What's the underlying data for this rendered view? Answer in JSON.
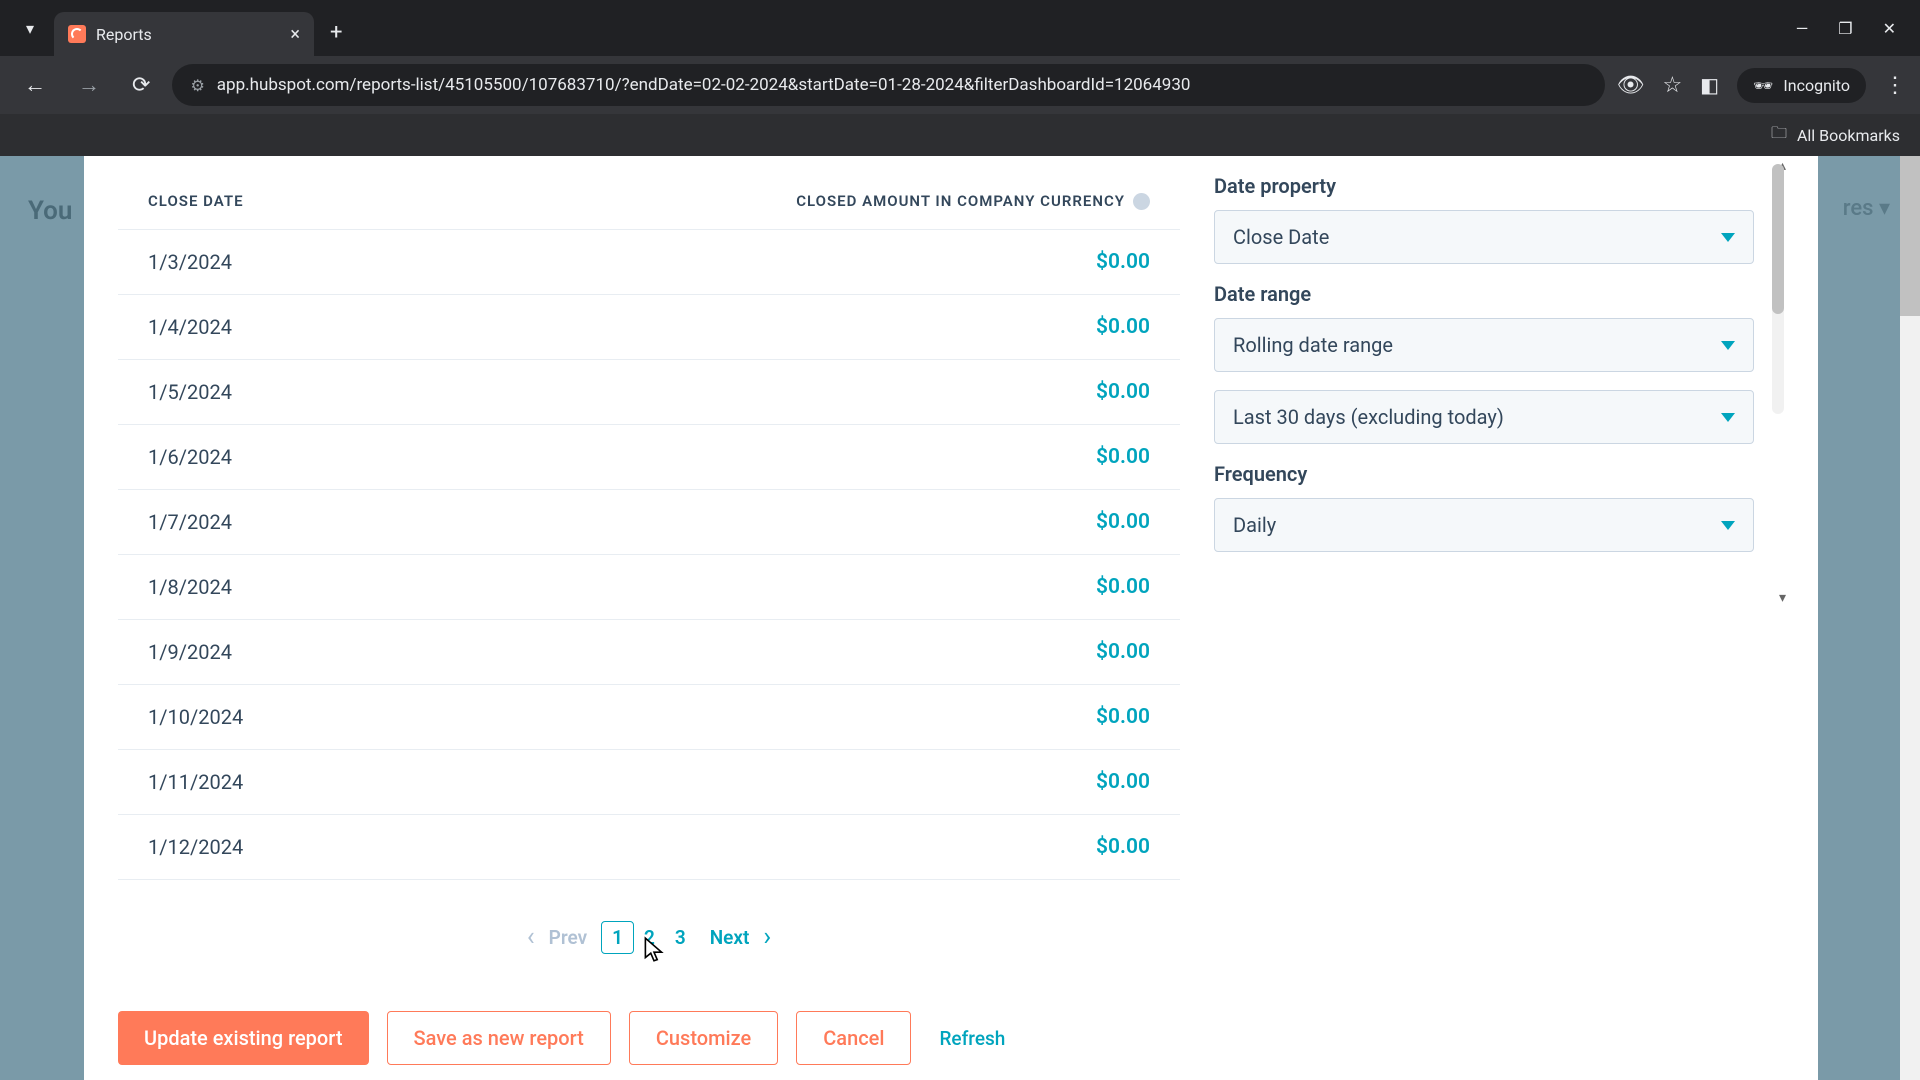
{
  "browser": {
    "tab_title": "Reports",
    "url": "app.hubspot.com/reports-list/45105500/107683710/?endDate=02-02-2024&startDate=01-28-2024&filterDashboardId=12064930",
    "incognito_label": "Incognito",
    "bookmarks_label": "All Bookmarks"
  },
  "background": {
    "you_text": "You",
    "right_text": "res"
  },
  "table": {
    "col1": "CLOSE DATE",
    "col2": "CLOSED AMOUNT IN COMPANY CURRENCY",
    "rows": [
      {
        "date": "1/3/2024",
        "amount": "$0.00"
      },
      {
        "date": "1/4/2024",
        "amount": "$0.00"
      },
      {
        "date": "1/5/2024",
        "amount": "$0.00"
      },
      {
        "date": "1/6/2024",
        "amount": "$0.00"
      },
      {
        "date": "1/7/2024",
        "amount": "$0.00"
      },
      {
        "date": "1/8/2024",
        "amount": "$0.00"
      },
      {
        "date": "1/9/2024",
        "amount": "$0.00"
      },
      {
        "date": "1/10/2024",
        "amount": "$0.00"
      },
      {
        "date": "1/11/2024",
        "amount": "$0.00"
      },
      {
        "date": "1/12/2024",
        "amount": "$0.00"
      }
    ]
  },
  "pagination": {
    "prev": "Prev",
    "pages": [
      "1",
      "2",
      "3"
    ],
    "current": "1",
    "next": "Next"
  },
  "filters": {
    "date_property_label": "Date property",
    "date_property_value": "Close Date",
    "date_range_label": "Date range",
    "date_range_value": "Rolling date range",
    "date_range_value2": "Last 30 days (excluding today)",
    "frequency_label": "Frequency",
    "frequency_value": "Daily"
  },
  "footer": {
    "update": "Update existing report",
    "save": "Save as new report",
    "customize": "Customize",
    "cancel": "Cancel",
    "refresh": "Refresh"
  }
}
